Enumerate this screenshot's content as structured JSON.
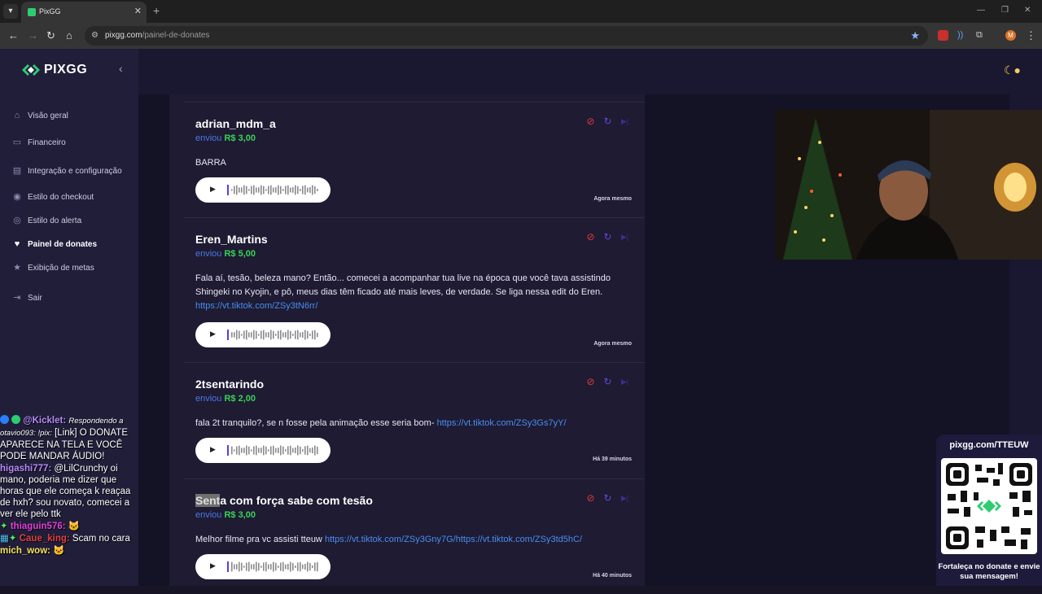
{
  "browser": {
    "tab_title": "PixGG",
    "url_domain": "pixgg.com",
    "url_path": "/painel-de-donates"
  },
  "sidebar": {
    "brand": "PIXGG",
    "items": [
      {
        "label": "Visão geral",
        "icon": "home-icon"
      },
      {
        "label": "Financeiro",
        "icon": "wallet-icon"
      },
      {
        "label": "Integração e configuração",
        "icon": "settings-icon"
      },
      {
        "label": "Estilo do checkout",
        "icon": "palette-icon"
      },
      {
        "label": "Estilo do alerta",
        "icon": "palette-icon"
      },
      {
        "label": "Painel de donates",
        "icon": "donate-icon",
        "active": true
      },
      {
        "label": "Exibição de metas",
        "icon": "star-icon"
      },
      {
        "label": "Sair",
        "icon": "logout-icon"
      }
    ]
  },
  "donations": [
    {
      "name": "adrian_mdm_a",
      "sent_label": "enviou",
      "amount": "R$ 3,00",
      "message": "BARRA",
      "time": "Agora mesmo"
    },
    {
      "name": "Eren_Martins",
      "sent_label": "enviou",
      "amount": "R$ 5,00",
      "message": "Fala aí, tesão, beleza mano? Então... comecei a acompanhar tua live na época que você tava assistindo Shingeki no Kyojin, e pô, meus dias têm ficado até mais leves, de verdade. Se liga nessa edit do Eren.",
      "link": "https://vt.tiktok.com/ZSy3tN6rr/",
      "time": "Agora mesmo"
    },
    {
      "name": "2tsentarindo",
      "sent_label": "enviou",
      "amount": "R$ 2,00",
      "message": "fala 2t tranquilo?, se n fosse pela animação esse seria bom-",
      "link": "https://vt.tiktok.com/ZSy3Gs7yY/",
      "time": "Há 39 minutos"
    },
    {
      "name_highlight": "Sent",
      "name_rest": "a com força sabe com tesão",
      "sent_label": "enviou",
      "amount": "R$ 3,00",
      "message": "Melhor filme pra vc assisti tteuw",
      "link": "https://vt.tiktok.com/ZSy3Gny7G/https://vt.tiktok.com/ZSy3td5hC/",
      "time": "Há 40 minutos"
    }
  ],
  "chat": {
    "lines": [
      {
        "user": "@Kicklet:",
        "reply": "Respondendo a otavio093: !pix:",
        "text": "[Link] O DONATE APARECE NA TELA E VOCÊ PODE MANDAR ÁUDIO!"
      },
      {
        "user": "higashi777:",
        "text": "@LilCrunchy oi mano, poderia me dizer que horas que ele começa k reaçaa de hxh? sou novato, comecei a ver ele pelo ttk"
      },
      {
        "user": "thiaguin576:",
        "text": ""
      },
      {
        "user": "Caue_king:",
        "text": "Scam no cara"
      },
      {
        "user": "mich_wow:",
        "text": ""
      }
    ]
  },
  "qr_card": {
    "title": "pixgg.com/TTEUW",
    "caption": "Fortaleça no donate e envie sua mensagem!"
  },
  "colors": {
    "sidebar_bg": "#211e3a",
    "panel_bg": "#1e1b33",
    "amount_green": "#39d353",
    "link_blue": "#4a8df0",
    "ban_red": "#e03a3a"
  }
}
